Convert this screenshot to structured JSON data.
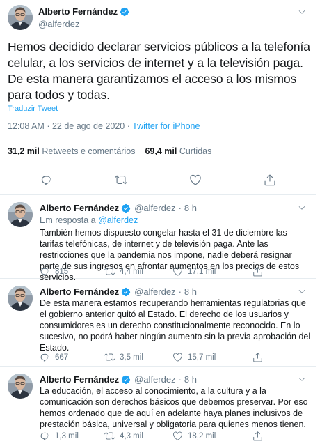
{
  "colors": {
    "link": "#1da1f2",
    "muted": "#657786",
    "text": "#14171a",
    "divider": "#e6ecf0"
  },
  "main_tweet": {
    "author_name": "Alberto Fernández",
    "handle": "@alferdez",
    "text": "Hemos decidido declarar servicios públicos a la telefonía celular, a los servicios de internet y a la televisión paga. De esta manera garantizamos el acceso a los mismos para todos y todas.",
    "translate_label": "Traduzir Tweet",
    "time": "12:08 AM",
    "date": "22 de ago de 2020",
    "separator": "·",
    "source": "Twitter for iPhone",
    "retweets_count": "31,2 mil",
    "retweets_label": "Retweets e comentários",
    "likes_count": "69,4 mil",
    "likes_label": "Curtidas",
    "icons": [
      "reply-icon",
      "retweet-icon",
      "like-icon",
      "share-icon",
      "chevron-down-icon",
      "verified-icon"
    ]
  },
  "replies": [
    {
      "author_name": "Alberto Fernández",
      "handle": "@alferdez",
      "separator": "·",
      "age": "8 h",
      "reply_prefix": "Em resposta a",
      "reply_handle": "@alferdez",
      "text": "También hemos dispuesto congelar hasta el 31 de diciembre las tarifas telefónicas, de internet y de televisión paga. Ante las restricciones que la pandemia nos impone, nadie deberá resignar parte de sus ingresos en afrontar aumentos en los precios de estos servicios.",
      "reply_count": "815",
      "retweet_count": "4,4 mil",
      "like_count": "17,1 mil"
    },
    {
      "author_name": "Alberto Fernández",
      "handle": "@alferdez",
      "separator": "·",
      "age": "8 h",
      "text": "De esta manera estamos recuperando herramientas regulatorias que el gobierno anterior quitó al Estado. El derecho de los usuarios y consumidores es un derecho constitucionalmente reconocido. En lo sucesivo, no podrá haber ningún aumento sin la previa aprobación del Estado.",
      "reply_count": "667",
      "retweet_count": "3,5 mil",
      "like_count": "15,7 mil"
    },
    {
      "author_name": "Alberto Fernández",
      "handle": "@alferdez",
      "separator": "·",
      "age": "8 h",
      "text": "La educación, el acceso al conocimiento, a la cultura y a la comunicación son derechos básicos que debemos preservar. Por eso hemos ordenado que de aquí en adelante haya planes inclusivos de prestación básica, universal y obligatoria para quienes menos tienen.",
      "reply_count": "1,3 mil",
      "retweet_count": "4,3 mil",
      "like_count": "18,2 mil"
    }
  ]
}
